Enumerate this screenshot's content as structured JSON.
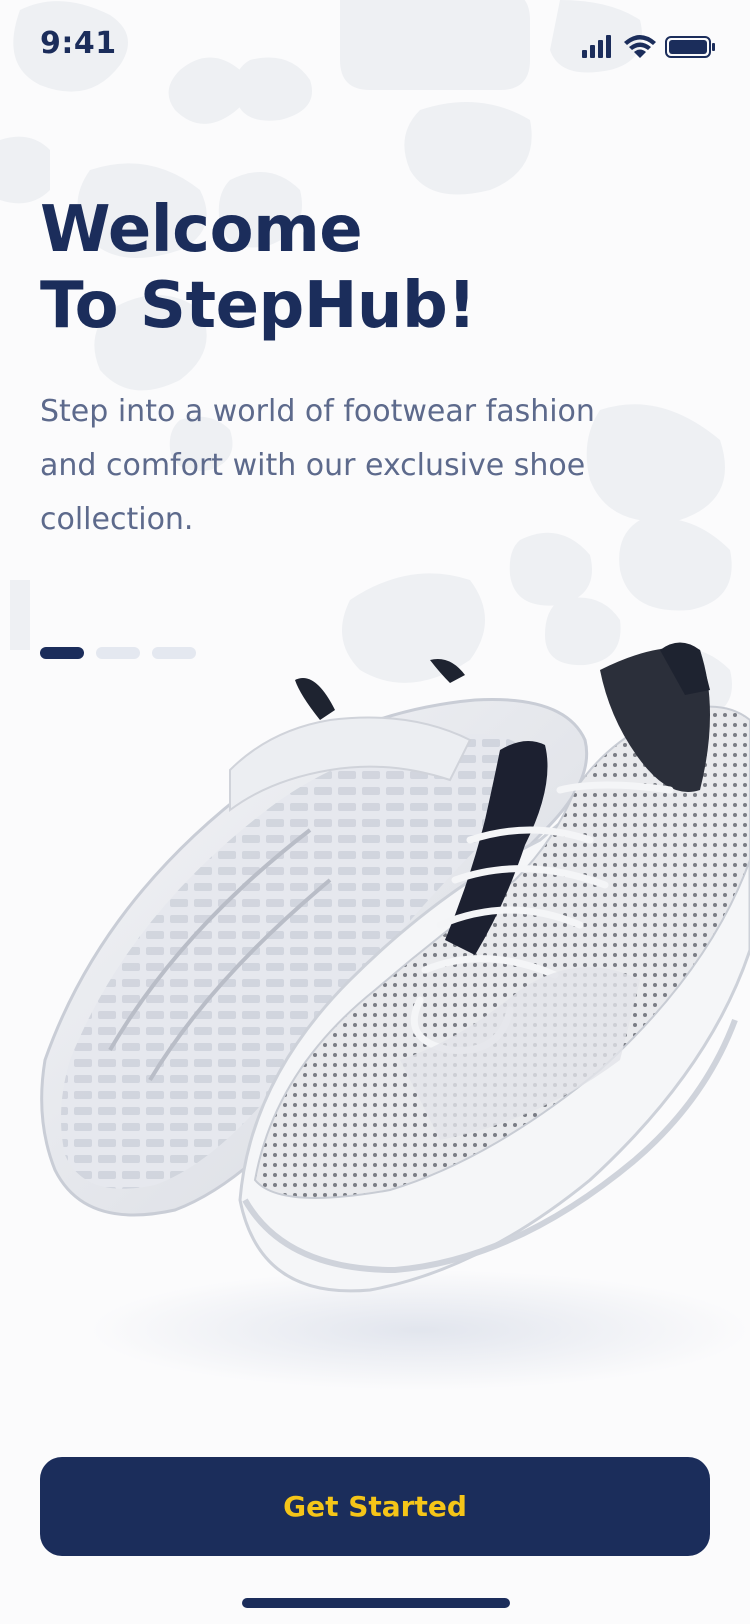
{
  "status_bar": {
    "time": "9:41",
    "signal_icon": "cellular-signal-icon",
    "wifi_icon": "wifi-icon",
    "battery_icon": "battery-icon"
  },
  "onboarding": {
    "title_line1": "Welcome",
    "title_line2": "To StepHub!",
    "subtitle": "Step into a world of footwear fashion and comfort with our exclusive shoe collection.",
    "pager": {
      "total_pages": 3,
      "current_page": 1
    },
    "hero_image": "white-knit-sneakers-image",
    "cta_label": "Get Started"
  },
  "colors": {
    "primary": "#1b2d5b",
    "accent": "#f5c518",
    "text_secondary": "#5d6a8c",
    "pager_inactive": "#e4e8f0"
  }
}
